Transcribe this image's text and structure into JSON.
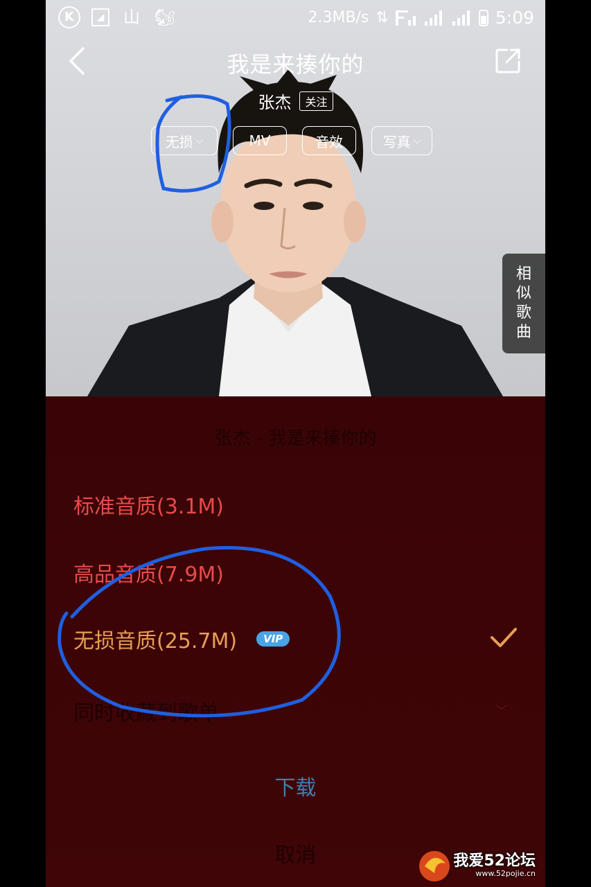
{
  "status_bar": {
    "left_icons": [
      "k-app-icon",
      "gallery-icon",
      "mountain-icon",
      "uc-browser-icon"
    ],
    "net_speed": "2.3MB/s",
    "net_arrows": "⇅",
    "time": "5:09"
  },
  "player": {
    "title": "我是来揍你的",
    "artist": "张杰",
    "follow_label": "关注",
    "pills": {
      "quality": "无损",
      "mv": "MV",
      "effects": "音效",
      "photo": "写真"
    },
    "side_tab": [
      "相",
      "似",
      "歌",
      "曲"
    ]
  },
  "sheet": {
    "title": "张杰 - 我是来揍你的",
    "options": [
      {
        "label": "标准音质(3.1M)"
      },
      {
        "label": "高品音质(7.9M)"
      },
      {
        "label": "无损音质(25.7M)",
        "badge": "VIP",
        "selected": true
      }
    ],
    "playlist_label": "同时收藏到歌单",
    "download_label": "下载",
    "cancel_label": "取消"
  },
  "watermark": {
    "text": "我爱52论坛",
    "url": "www.52pojie.cn"
  },
  "colors": {
    "sheet_bg": "#3a0406",
    "option_red": "#e64b4b",
    "option_selected": "#e89e55",
    "vip_badge": "#4aa3e6",
    "download_blue": "#3d7fb3",
    "annotation_blue": "#1f5fe0"
  }
}
